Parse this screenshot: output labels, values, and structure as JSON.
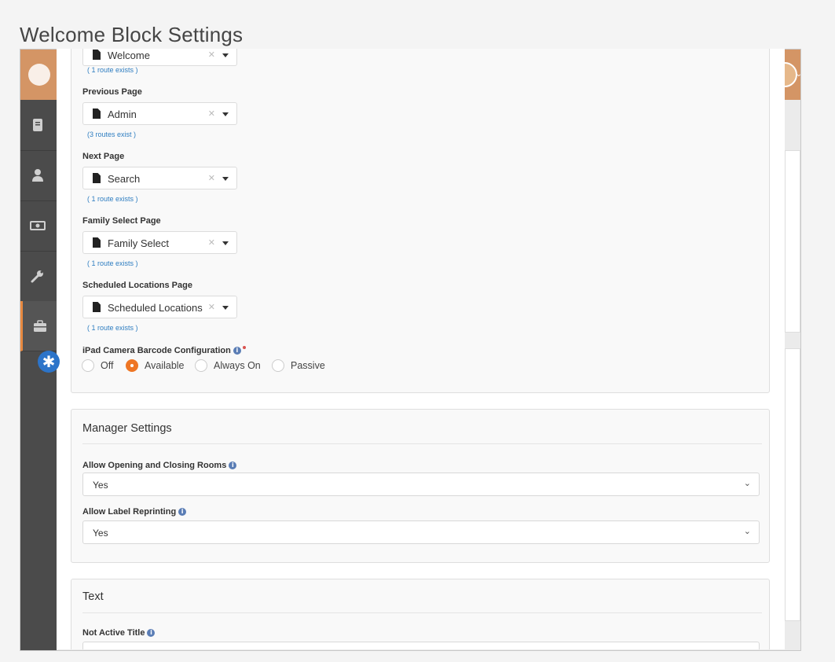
{
  "page_title": "Welcome Block Settings",
  "page_fields": [
    {
      "label": "",
      "value": "Welcome",
      "routes": "( 1 route exists )"
    },
    {
      "label": "Previous Page",
      "value": "Admin",
      "routes": "(3 routes exist )"
    },
    {
      "label": "Next Page",
      "value": "Search",
      "routes": "( 1 route exists )"
    },
    {
      "label": "Family Select Page",
      "value": "Family Select",
      "routes": "( 1 route exists )"
    },
    {
      "label": "Scheduled Locations Page",
      "value": "Scheduled Locations",
      "routes": "( 1 route exists )"
    }
  ],
  "barcode": {
    "label": "iPad Camera Barcode Configuration",
    "options": [
      "Off",
      "Available",
      "Always On",
      "Passive"
    ],
    "selected": "Available"
  },
  "manager_settings": {
    "title": "Manager Settings",
    "fields": [
      {
        "label": "Allow Opening and Closing Rooms",
        "value": "Yes"
      },
      {
        "label": "Allow Label Reprinting",
        "value": "Yes"
      }
    ]
  },
  "text_section": {
    "title": "Text",
    "fields": [
      {
        "label": "Not Active Title",
        "value": ""
      }
    ]
  },
  "icons": {
    "picker_item": "file-icon",
    "clear": "clear-icon",
    "dropdown": "caret-down-icon",
    "info": "info-icon",
    "badge": "asterisk-icon"
  },
  "colors": {
    "accent": "#ee7625",
    "link": "#2f7ec1",
    "header": "#d49565",
    "sidebar": "#4b4b4b",
    "badge": "#2c74c9"
  }
}
